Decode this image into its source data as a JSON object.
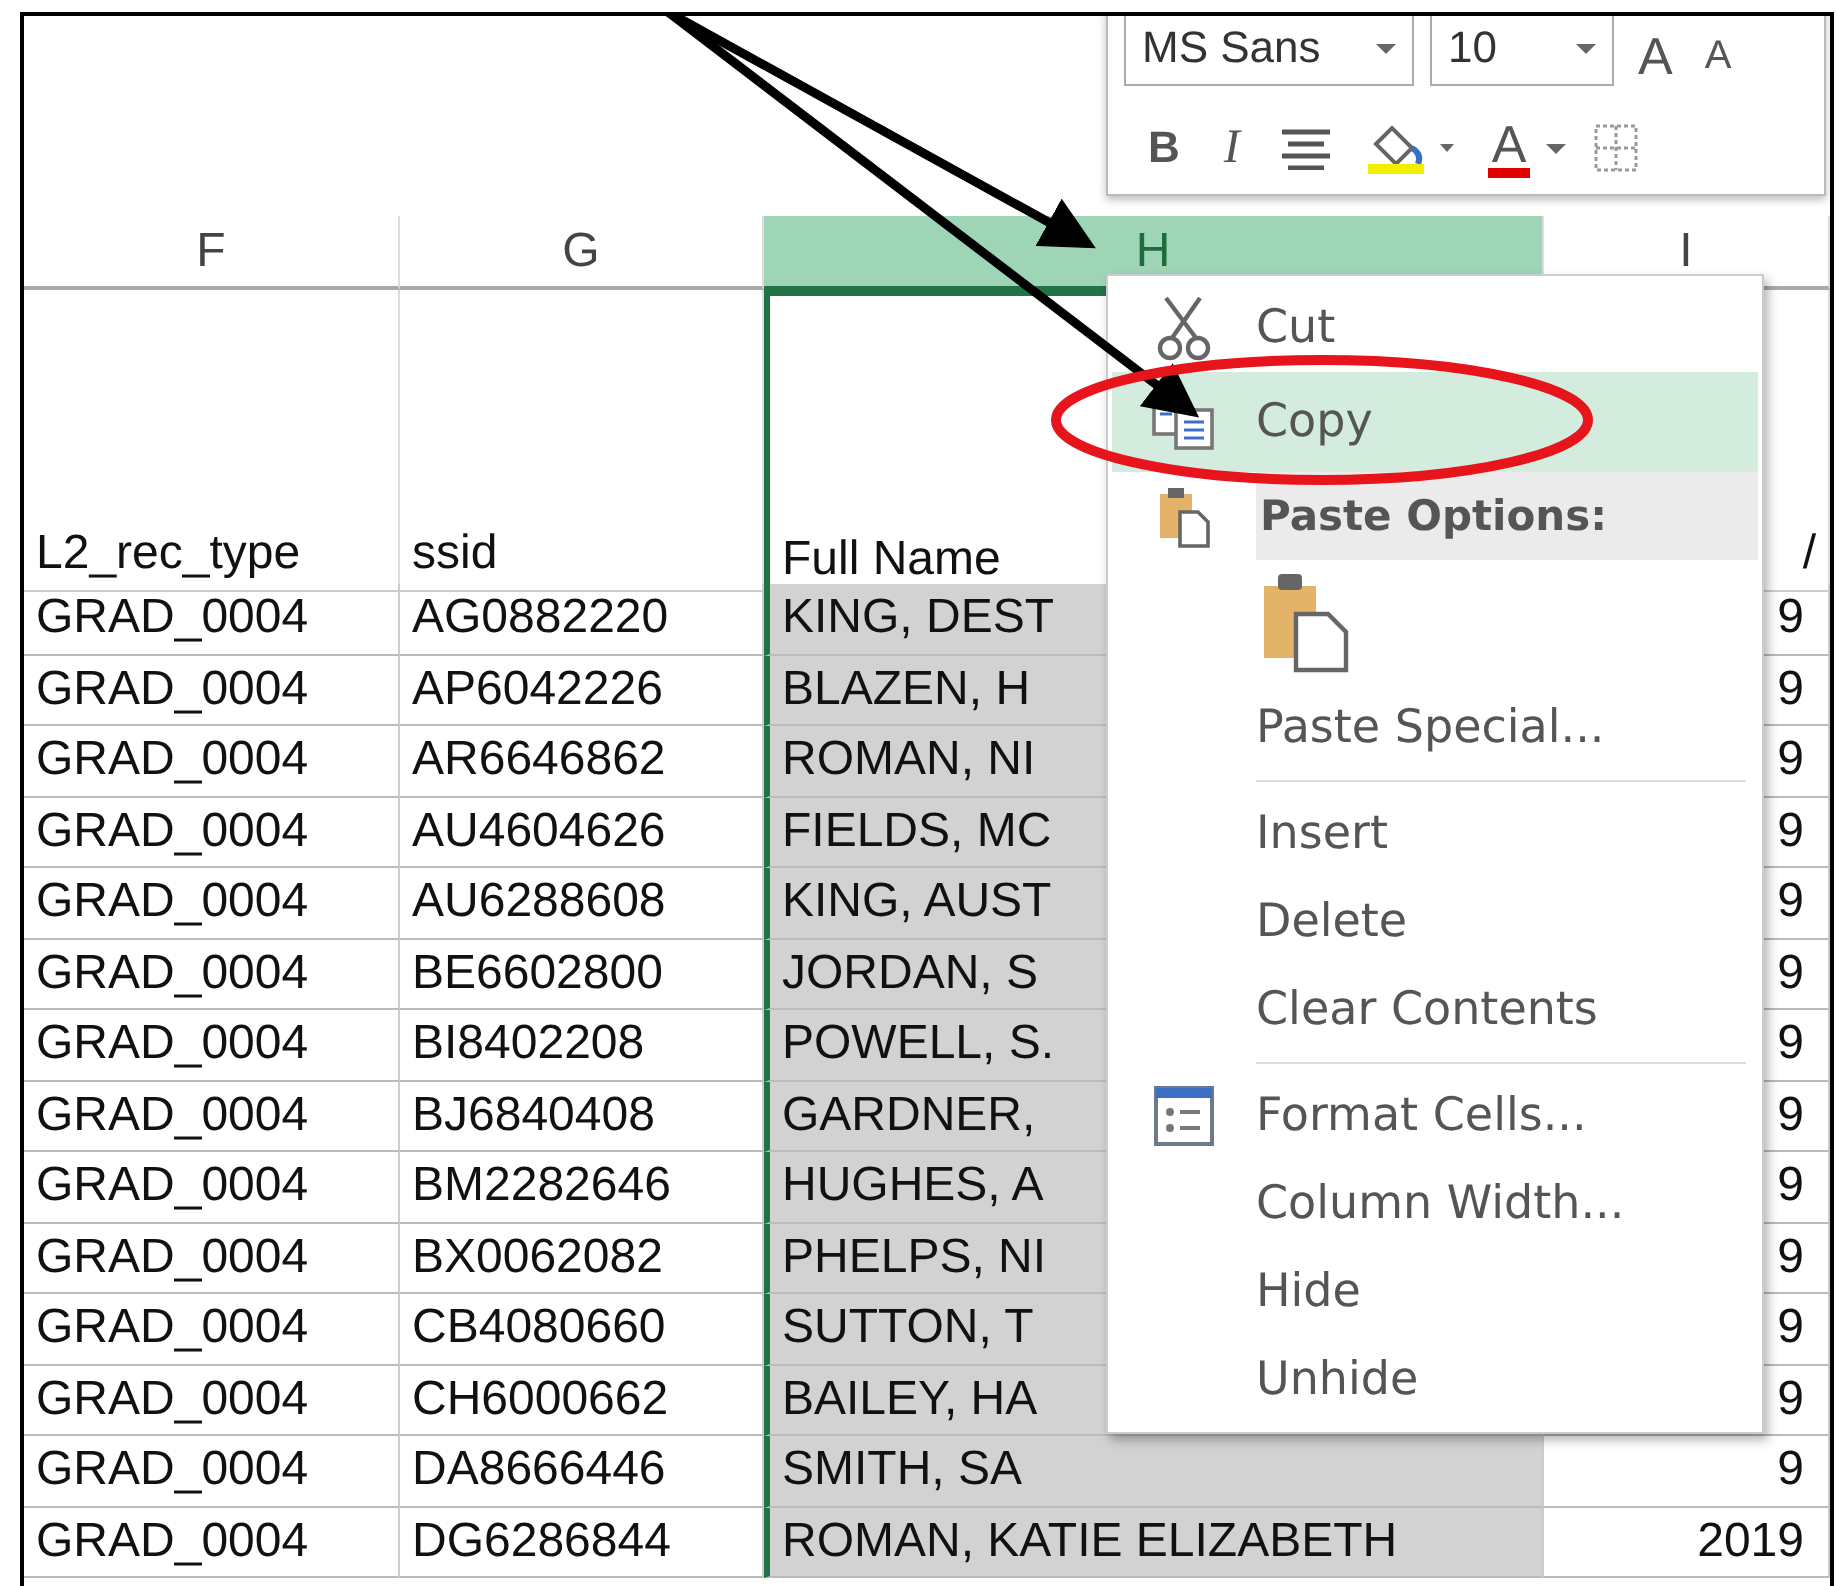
{
  "mini_toolbar": {
    "font": "MS Sans",
    "size": "10",
    "row1_buttons": [
      {
        "kind": "grow",
        "label": "A"
      },
      {
        "kind": "shrink",
        "label": "A"
      }
    ],
    "row2_buttons": [
      {
        "kind": "bold",
        "label": "B"
      },
      {
        "kind": "italic",
        "label": "I"
      },
      {
        "kind": "align"
      },
      {
        "kind": "fill"
      },
      {
        "kind": "font-color",
        "label": "A"
      },
      {
        "kind": "borders"
      }
    ]
  },
  "columns": [
    {
      "letter": "F",
      "heading": "L2_rec_type",
      "selected": false
    },
    {
      "letter": "G",
      "heading": "ssid",
      "selected": false
    },
    {
      "letter": "H",
      "heading": "Full Name",
      "selected": true
    },
    {
      "letter": "I",
      "heading": "/",
      "selected": false
    }
  ],
  "rows": [
    [
      "GRAD_0004",
      "AG0882220",
      "KING, DEST",
      "9"
    ],
    [
      "GRAD_0004",
      "AP6042226",
      "BLAZEN, H",
      "9"
    ],
    [
      "GRAD_0004",
      "AR6646862",
      "ROMAN, NI",
      "9"
    ],
    [
      "GRAD_0004",
      "AU4604626",
      "FIELDS, MC",
      "9"
    ],
    [
      "GRAD_0004",
      "AU6288608",
      "KING, AUST",
      "9"
    ],
    [
      "GRAD_0004",
      "BE6602800",
      "JORDAN, S",
      "9"
    ],
    [
      "GRAD_0004",
      "BI8402208",
      "POWELL, S.",
      "9"
    ],
    [
      "GRAD_0004",
      "BJ6840408",
      "GARDNER,",
      "9"
    ],
    [
      "GRAD_0004",
      "BM2282646",
      "HUGHES, A",
      "9"
    ],
    [
      "GRAD_0004",
      "BX0062082",
      "PHELPS, NI",
      "9"
    ],
    [
      "GRAD_0004",
      "CB4080660",
      "SUTTON, T",
      "9"
    ],
    [
      "GRAD_0004",
      "CH6000662",
      "BAILEY, HA",
      "9"
    ],
    [
      "GRAD_0004",
      "DA8666446",
      "SMITH, SA",
      "9"
    ],
    [
      "GRAD_0004",
      "DG6286844",
      "ROMAN, KATIE ELIZABETH",
      "2019"
    ]
  ],
  "context_menu": [
    {
      "kind": "item",
      "label": "Cut",
      "selected": false
    },
    {
      "kind": "item",
      "label": "Copy",
      "selected": true
    },
    {
      "kind": "header",
      "label": "Paste Options:"
    },
    {
      "kind": "paste-icons"
    },
    {
      "kind": "item",
      "label": "Paste Special...",
      "selected": false
    },
    {
      "kind": "separator"
    },
    {
      "kind": "item",
      "label": "Insert",
      "selected": false
    },
    {
      "kind": "item",
      "label": "Delete",
      "selected": false
    },
    {
      "kind": "item",
      "label": "Clear Contents",
      "selected": false
    },
    {
      "kind": "separator"
    },
    {
      "kind": "item",
      "label": "Format Cells...",
      "selected": false
    },
    {
      "kind": "item",
      "label": "Column Width...",
      "selected": false
    },
    {
      "kind": "item",
      "label": "Hide",
      "selected": false
    },
    {
      "kind": "item",
      "label": "Unhide",
      "selected": false
    }
  ]
}
